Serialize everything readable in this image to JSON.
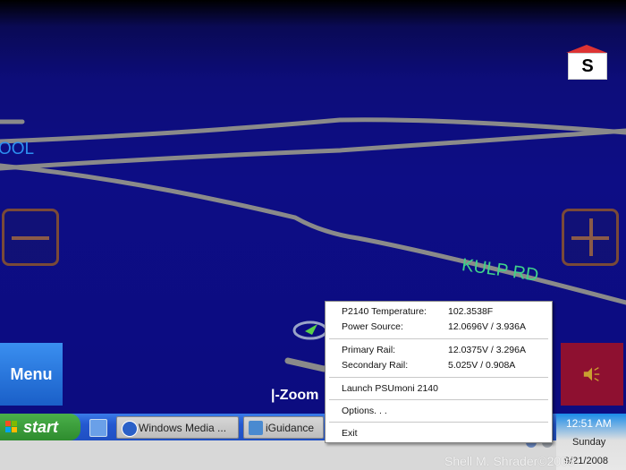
{
  "map": {
    "road_labels": {
      "kulp": "KULP RD",
      "ool": "OOL"
    },
    "compass": {
      "letter": "S",
      "roof_color": "#d33333"
    },
    "zoom_out_icon": "minus-icon",
    "zoom_in_icon": "plus-icon",
    "menu_label": "Menu",
    "zoom_label": "|-Zoom",
    "sound_icon": "speaker-icon"
  },
  "taskbar": {
    "start_label": "start",
    "tasks": [
      {
        "label": "Windows Media ...",
        "icon": "media-player-icon"
      },
      {
        "label": "iGuidance",
        "icon": "iguidance-icon"
      }
    ],
    "clock": {
      "time": "12:51 AM",
      "day": "Sunday",
      "date": "9/21/2008"
    }
  },
  "context_menu": {
    "items": [
      {
        "label": "P2140 Temperature:",
        "value": "102.3538F"
      },
      {
        "label": "Power Source:",
        "value": "12.0696V / 3.936A"
      },
      {
        "label": "Primary Rail:",
        "value": "12.0375V / 3.296A"
      },
      {
        "label": "Secondary Rail:",
        "value": "5.025V / 0.908A"
      },
      {
        "label": "Launch PSUmoni 2140"
      },
      {
        "label": "Options. . ."
      },
      {
        "label": "Exit"
      }
    ]
  },
  "watermark": "Shell M. Shrader©2008",
  "colors": {
    "map_bg": "#0d0d80",
    "road": "#8a8a8a",
    "menu_btn": "#2a77e0",
    "sound_btn": "#8e1030"
  }
}
